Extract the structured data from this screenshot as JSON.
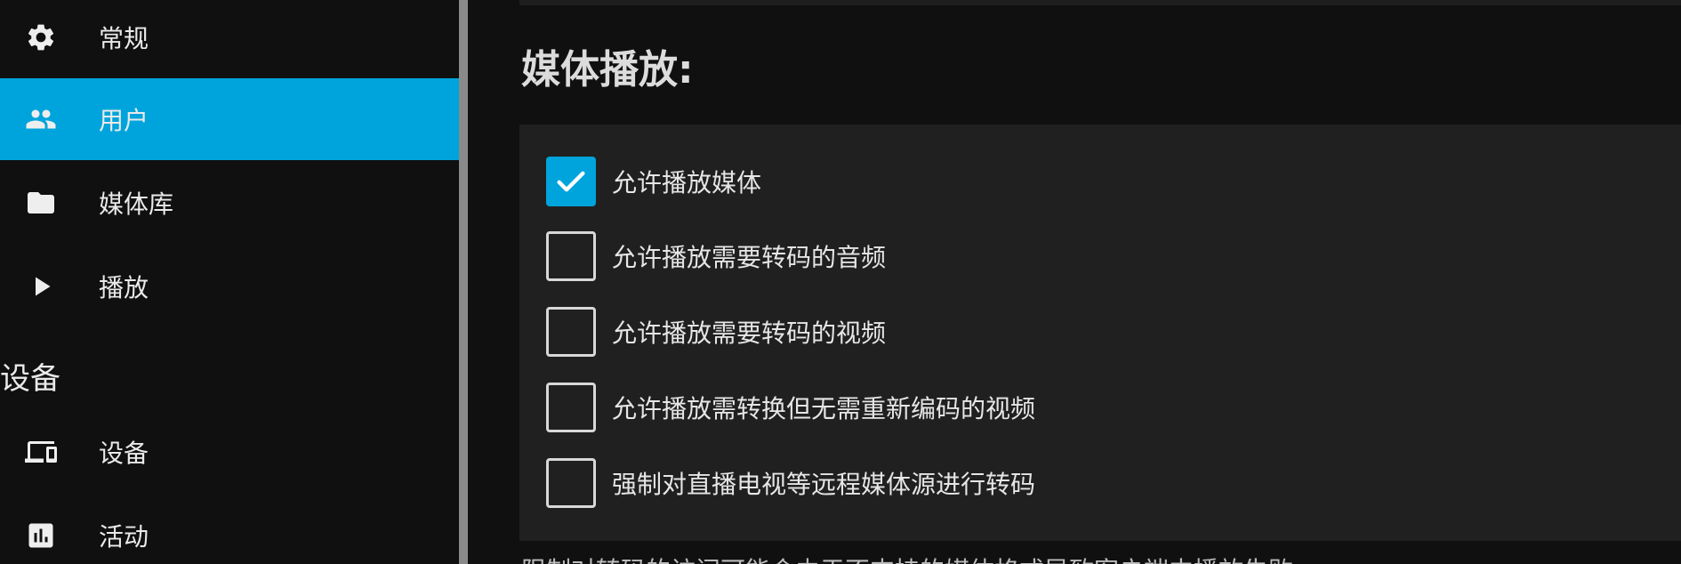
{
  "sidebar": {
    "items": [
      {
        "label": "常规",
        "icon": "gear-icon",
        "active": false
      },
      {
        "label": "用户",
        "icon": "users-icon",
        "active": true
      },
      {
        "label": "媒体库",
        "icon": "folder-icon",
        "active": false
      },
      {
        "label": "播放",
        "icon": "play-icon",
        "active": false
      }
    ],
    "section_devices": "设备",
    "device_items": [
      {
        "label": "设备",
        "icon": "devices-icon"
      },
      {
        "label": "活动",
        "icon": "bar-chart-icon"
      }
    ]
  },
  "main": {
    "section_title": "媒体播放:",
    "options": [
      {
        "label": "允许播放媒体",
        "checked": true
      },
      {
        "label": "允许播放需要转码的音频",
        "checked": false
      },
      {
        "label": "允许播放需要转码的视频",
        "checked": false
      },
      {
        "label": "允许播放需转换但无需重新编码的视频",
        "checked": false
      },
      {
        "label": "强制对直播电视等远程媒体源进行转码",
        "checked": false
      }
    ],
    "footnote": "限制对转码的访问可能会由于不支持的媒体格式导致客户端中播放失败。"
  },
  "colors": {
    "accent": "#00a4dc",
    "background": "#101010",
    "panel": "#202020"
  }
}
